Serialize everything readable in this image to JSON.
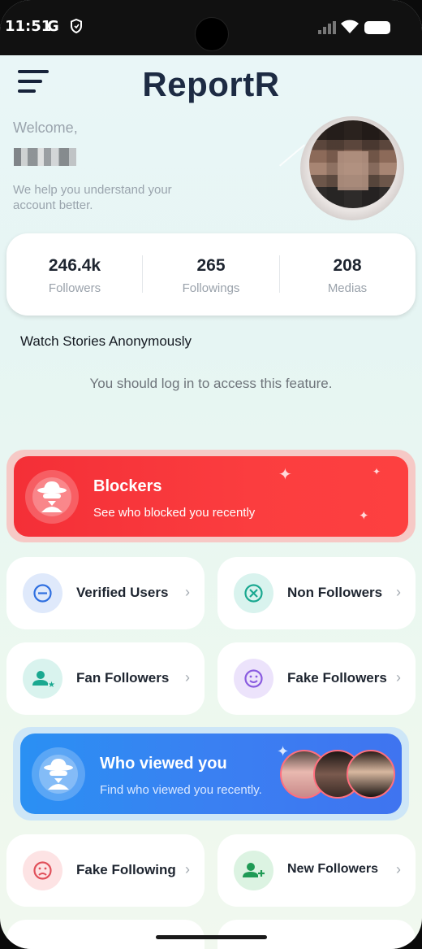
{
  "status_bar": {
    "time": "11:51",
    "g_label": "G"
  },
  "header": {
    "app_title": "ReportR"
  },
  "profile": {
    "welcome": "Welcome,",
    "tagline": "We help you understand your account better."
  },
  "stats": [
    {
      "value": "246.4k",
      "label": "Followers"
    },
    {
      "value": "265",
      "label": "Followings"
    },
    {
      "value": "208",
      "label": "Medias"
    }
  ],
  "stories": {
    "title": "Watch Stories Anonymously",
    "login_note": "You should log in to access this feature."
  },
  "blockers": {
    "title": "Blockers",
    "subtitle": "See who blocked you recently",
    "accent": "#f42f37"
  },
  "cards": {
    "verified_users": "Verified Users",
    "non_followers": "Non Followers",
    "fan_followers": "Fan Followers",
    "fake_followers": "Fake Followers",
    "fake_following": "Fake Following",
    "new_followers": "New Followers",
    "chevron": "›"
  },
  "viewed": {
    "title": "Who viewed you",
    "subtitle": "Find who viewed you recently.",
    "accent": "#2a90f3"
  },
  "icons": {
    "menu": "hamburger-menu-icon",
    "blockers": "spy-icon",
    "verified": "minus-circle-icon",
    "non_followers": "x-circle-icon",
    "fan_followers": "user-star-icon",
    "fake_followers": "smile-face-icon",
    "fake_following": "sad-face-icon",
    "new_followers": "user-plus-icon",
    "viewed": "spy-icon"
  }
}
